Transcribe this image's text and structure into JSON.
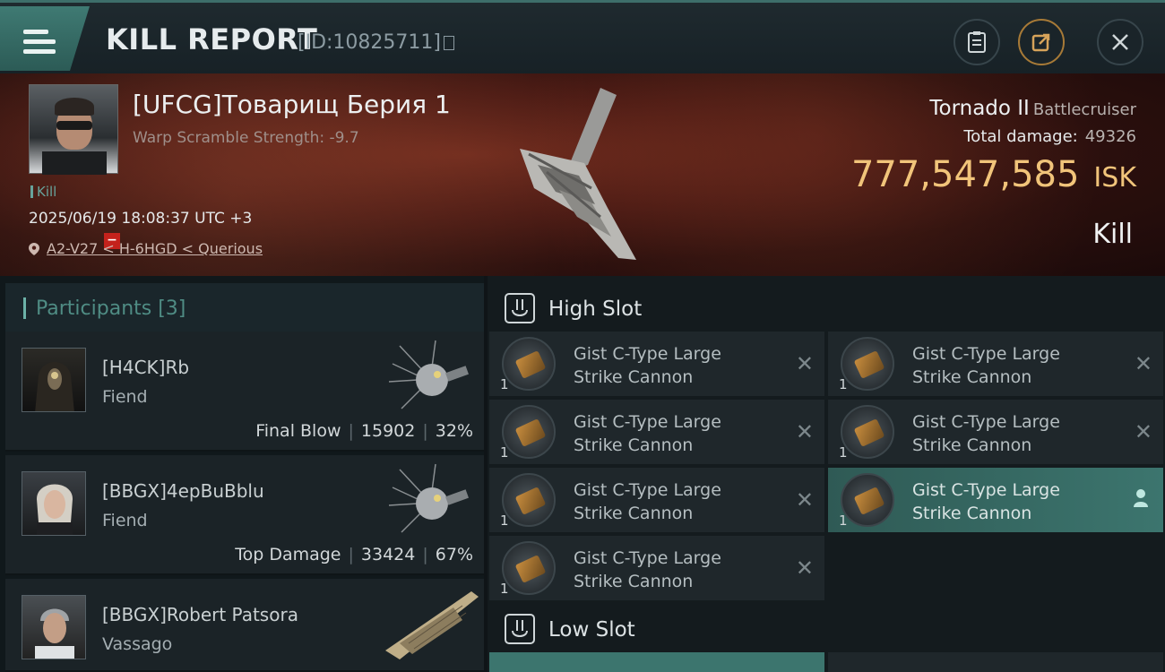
{
  "header": {
    "title": "KILL REPORT",
    "report_id": "[ID:10825711]"
  },
  "victim": {
    "name": "[UFCG]Товарищ Берия 1",
    "warp_scramble": "Warp Scramble Strength: -9.7",
    "kill_tag": "Kill",
    "datetime": "2025/06/19 18:08:37 UTC +3",
    "location": "A2-V27 < H-6HGD < Querious",
    "ship_name": "Tornado II",
    "ship_class": "Battlecruiser",
    "total_damage_label": "Total damage:",
    "total_damage_value": "49326",
    "isk_value": "777,547,585",
    "isk_currency": "ISK",
    "result": "Kill"
  },
  "participants": {
    "header": "Participants [3]",
    "rows": [
      {
        "name": "[H4CK]Rb",
        "ship": "Fiend",
        "label": "Final Blow",
        "damage": "15902",
        "percent": "32%"
      },
      {
        "name": "[BBGX]4epBuBblu",
        "ship": "Fiend",
        "label": "Top Damage",
        "damage": "33424",
        "percent": "67%"
      },
      {
        "name": "[BBGX]Robert Patsora",
        "ship": "Vassago",
        "label": "",
        "damage": "",
        "percent": ""
      }
    ]
  },
  "fitting": {
    "high_slot_label": "High Slot",
    "low_slot_label": "Low Slot",
    "high_slot_modules": [
      {
        "line1": "Gist C-Type Large",
        "line2": "Strike Cannon",
        "qty": "1",
        "status": "destroyed"
      },
      {
        "line1": "Gist C-Type Large",
        "line2": "Strike Cannon",
        "qty": "1",
        "status": "destroyed"
      },
      {
        "line1": "Gist C-Type Large",
        "line2": "Strike Cannon",
        "qty": "1",
        "status": "destroyed"
      },
      {
        "line1": "Gist C-Type Large",
        "line2": "Strike Cannon",
        "qty": "1",
        "status": "destroyed"
      },
      {
        "line1": "Gist C-Type Large",
        "line2": "Strike Cannon",
        "qty": "1",
        "status": "destroyed"
      },
      {
        "line1": "Gist C-Type Large",
        "line2": "Strike Cannon",
        "qty": "1",
        "status": "dropped-selected"
      },
      {
        "line1": "Gist C-Type Large",
        "line2": "Strike Cannon",
        "qty": "1",
        "status": "destroyed"
      }
    ]
  },
  "icons": [
    "hamburger-menu-icon",
    "copy-icon",
    "clipboard-icon",
    "share-icon",
    "close-icon",
    "location-pin-icon",
    "high-slot-icon",
    "low-slot-icon",
    "destroyed-x-icon",
    "dropped-user-icon"
  ],
  "colors": {
    "accent": "#3f7a73",
    "isk_gold": "#f1c47a",
    "kill_red": "#c4221c"
  }
}
